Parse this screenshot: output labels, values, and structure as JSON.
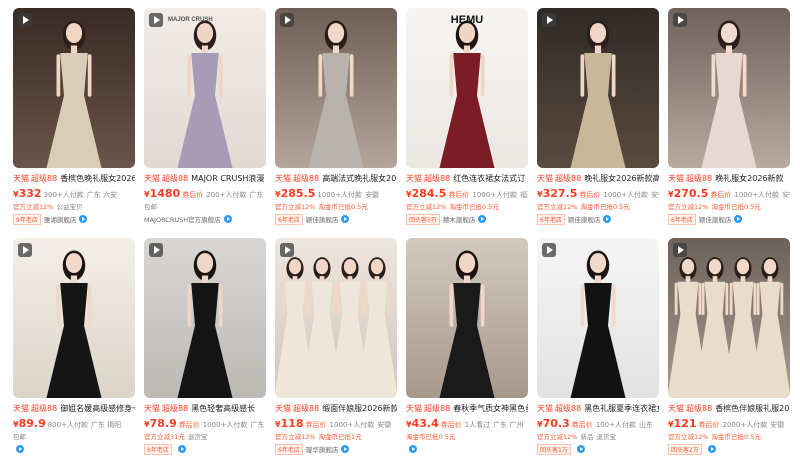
{
  "products": [
    {
      "title": "香槟色晚礼服女2026",
      "price": "332",
      "suffix": "300+人付款",
      "location": "广东 六安",
      "tags": [
        "官方立减12%",
        "公益宝贝"
      ],
      "shop_years": "9年老店",
      "shop": "雅湖旗舰店",
      "scene": "champagne",
      "video": true
    },
    {
      "title": "MAJOR CRUSH浪漫",
      "price": "1480",
      "price_note": "券后价",
      "suffix": "200+人付款",
      "location": "广东",
      "tags": [
        "包邮"
      ],
      "shop_years": "",
      "shop": "MAJORCRUSH官方旗舰店",
      "scene": "lilac",
      "video": true,
      "overlay": "MAJOR CRUSH"
    },
    {
      "title": "高端法式晚礼服女2026",
      "price": "285.5",
      "suffix": "1000+人付款",
      "location": "安徽",
      "tags": [
        "官方立减12%",
        "淘金币已抵0.5元"
      ],
      "shop_years": "6年老店",
      "shop": "颖佳旗舰店",
      "scene": "silver",
      "video": true
    },
    {
      "title": "红色连衣裙女法式订",
      "price": "284.5",
      "price_note": "券后价",
      "suffix": "1000+人付款",
      "location": "福建",
      "tags": [
        "官方立减12%",
        "淘金币已抵0.5元"
      ],
      "shop_years": "回头客3万",
      "shop": "赫木旗舰店",
      "scene": "burgundy",
      "video": false,
      "overlay": "HEMU"
    },
    {
      "title": "晚礼服女2026新款高",
      "price": "327.5",
      "price_note": "券后价",
      "suffix": "1000+人付款",
      "location": "安徽",
      "tags": [
        "官方立减12%",
        "淘金币已抵0.5元"
      ],
      "shop_years": "6年老店",
      "shop": "颖佳旗舰店",
      "scene": "gold",
      "video": true
    },
    {
      "title": "晚礼服女2026新款",
      "price": "270.5",
      "price_note": "券后价",
      "suffix": "1000+人付款",
      "location": "安徽",
      "tags": [
        "官方立减12%",
        "淘金币已抵0.5元"
      ],
      "shop_years": "6年老店",
      "shop": "颖佳旗舰店",
      "scene": "blush",
      "video": true
    },
    {
      "title": "御姐名媛高级感修身一字肩",
      "price": "89.9",
      "suffix": "800+人付款",
      "location": "广东 揭阳",
      "tags": [
        "包邮"
      ],
      "shop_years": "",
      "shop": "",
      "scene": "black",
      "video": true
    },
    {
      "title": "黑色轻奢高级感长",
      "price": "78.9",
      "price_note": "券后价",
      "suffix": "1000+人付款",
      "location": "广东",
      "tags": [
        "官方立减31元",
        "退货宝"
      ],
      "shop_years": "6年老店",
      "shop": "",
      "scene": "noir",
      "video": true
    },
    {
      "title": "缎面伴娘服2026新款",
      "price": "118",
      "price_note": "券后价",
      "suffix": "1000+人付款",
      "location": "安徽",
      "tags": [
        "官方立减12%",
        "淘金币已抵1元"
      ],
      "shop_years": "6年老店",
      "shop": "璇华旗舰店",
      "scene": "bridesmaid",
      "video": true
    },
    {
      "title": "春秋季气质女神黑色丝绒",
      "price": "43.4",
      "price_note": "券后价",
      "suffix": "1人看过",
      "location": "广东 广州",
      "tags": [
        "淘金币已抵0.5元"
      ],
      "shop_years": "",
      "shop": "",
      "scene": "velvet",
      "video": false
    },
    {
      "title": "黑色礼服夏季连衣裙女",
      "price": "70.3",
      "price_note": "券后价",
      "suffix": "100+人付款",
      "location": "山东",
      "tags": [
        "官方立减12%",
        "新品",
        "退货宝"
      ],
      "shop_years": "回头客1万",
      "shop": "",
      "scene": "studio",
      "video": true
    },
    {
      "title": "香槟色伴娘服礼服2026",
      "price": "121",
      "price_note": "券后价",
      "suffix": "2000+人付款",
      "location": "安徽",
      "tags": [
        "官方立减12%",
        "淘金币已抵0.5元"
      ],
      "shop_years": "回头客2万",
      "shop": "",
      "scene": "champagne-group",
      "video": true
    }
  ],
  "common": {
    "badge_tmall": "天猫",
    "badge_88": "超级88",
    "currency": "¥"
  }
}
